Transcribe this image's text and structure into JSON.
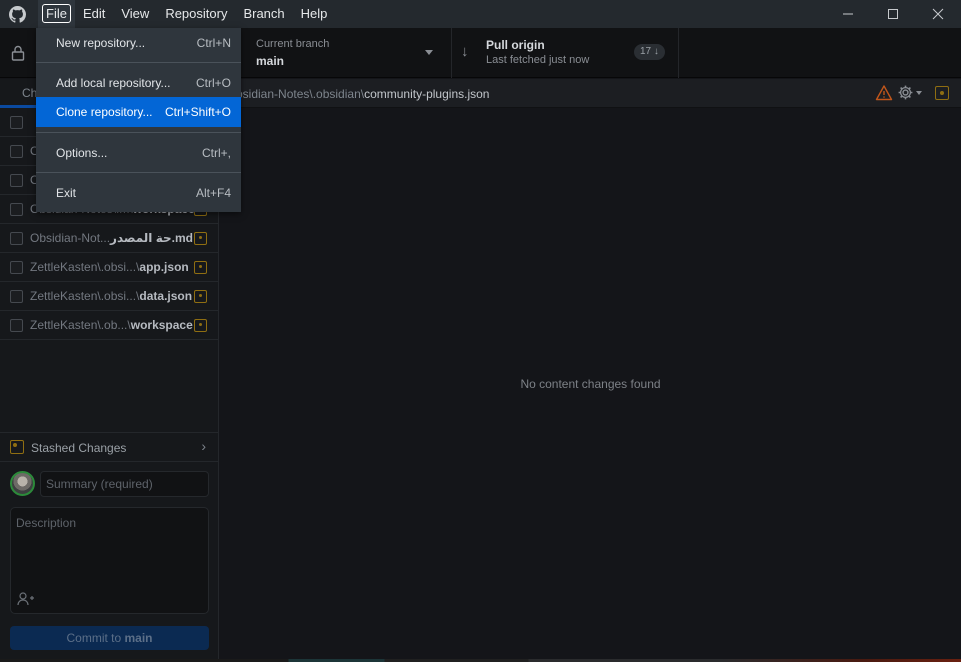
{
  "titlebar": {
    "app_icon": "github-icon",
    "menus": [
      "File",
      "Edit",
      "View",
      "Repository",
      "Branch",
      "Help"
    ],
    "open_menu": "File",
    "window_controls": [
      "minimize",
      "maximize",
      "close"
    ]
  },
  "toolbar": {
    "lock_icon": "lock-icon",
    "current_branch_label": "Current branch",
    "current_branch_value": "main",
    "pull_label": "Pull origin",
    "pull_subtitle": "Last fetched just now",
    "pull_badge": "17 ↓"
  },
  "file_menu": {
    "items": [
      {
        "label": "New repository...",
        "shortcut": "Ctrl+N"
      },
      {
        "label": "Add local repository...",
        "shortcut": "Ctrl+O"
      },
      {
        "label": "Clone repository...",
        "shortcut": "Ctrl+Shift+O",
        "highlighted": true
      },
      {
        "label": "Options...",
        "shortcut": "Ctrl+,"
      },
      {
        "label": "Exit",
        "shortcut": "Alt+F4"
      }
    ]
  },
  "sidebar": {
    "tab_label": "Changes",
    "files": [
      {
        "prefix": "",
        "name": ""
      },
      {
        "prefix": "O",
        "name": ""
      },
      {
        "prefix": "O",
        "name": ""
      },
      {
        "prefix": "Obsidian-Notes\\.m\\",
        "name": "workspace"
      },
      {
        "prefix": "Obsidian-Not...",
        "name": "حة المصدر.md"
      },
      {
        "prefix": "ZettleKasten\\.obsi...\\",
        "name": "app.json"
      },
      {
        "prefix": "ZettleKasten\\.obsi...\\",
        "name": "data.json"
      },
      {
        "prefix": "ZettleKasten\\.ob...\\",
        "name": "workspace"
      }
    ],
    "stash_label": "Stashed Changes",
    "summary_placeholder": "Summary (required)",
    "description_placeholder": "Description",
    "commit_prefix": "Commit to ",
    "commit_branch": "main"
  },
  "main": {
    "path_prefix": "bsidian-Notes\\.obsidian\\",
    "path_file": "community-plugins.json",
    "empty_message": "No content changes found"
  },
  "colors": {
    "accent": "#0366d6",
    "modified": "#8f6e12",
    "warning": "#c0561b"
  }
}
